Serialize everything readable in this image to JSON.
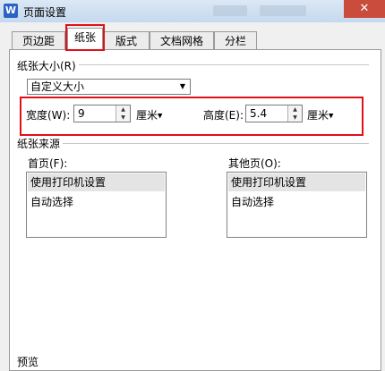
{
  "window": {
    "title": "页面设置",
    "app_icon_letter": "W",
    "close_glyph": "✕"
  },
  "tabs": [
    {
      "label": "页边距",
      "active": false
    },
    {
      "label": "纸张",
      "active": true
    },
    {
      "label": "版式",
      "active": false
    },
    {
      "label": "文档网格",
      "active": false
    },
    {
      "label": "分栏",
      "active": false
    }
  ],
  "paper_size": {
    "group_label": "纸张大小(R)",
    "selected": "自定义大小",
    "width_label": "宽度(W):",
    "width_value": "9",
    "width_unit": "厘米",
    "height_label": "高度(E):",
    "height_value": "5.4",
    "height_unit": "厘米"
  },
  "paper_source": {
    "group_label": "纸张来源",
    "first_page": {
      "label": "首页(F):",
      "items": [
        "使用打印机设置",
        "自动选择"
      ],
      "selected_index": 0
    },
    "other_pages": {
      "label": "其他页(O):",
      "items": [
        "使用打印机设置",
        "自动选择"
      ],
      "selected_index": 0
    }
  },
  "preview": {
    "group_label": "预览"
  },
  "colors": {
    "highlight_red": "#e0101a",
    "close_red": "#c94c3c",
    "selection_gray": "#e4e4e4"
  }
}
